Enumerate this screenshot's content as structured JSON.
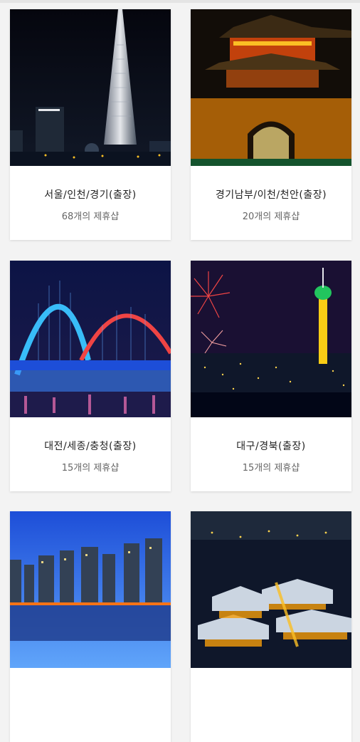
{
  "regions": [
    {
      "name": "서울/인천/경기(출장)",
      "count": "68개의 제휴샵",
      "photo": "seoul-lotte-tower-night"
    },
    {
      "name": "경기남부/이천/천안(출장)",
      "count": "20개의 제휴샵",
      "photo": "suwon-fortress-gate-night"
    },
    {
      "name": "대전/세종/충청(출장)",
      "count": "15개의 제휴샵",
      "photo": "daejeon-expo-bridge-night"
    },
    {
      "name": "대구/경북(출장)",
      "count": "15개의 제휴샵",
      "photo": "daegu-tower-fireworks"
    },
    {
      "name": "",
      "count": "",
      "photo": "busan-skyline-night"
    },
    {
      "name": "",
      "count": "",
      "photo": "jeonju-hanok-village-night"
    }
  ]
}
